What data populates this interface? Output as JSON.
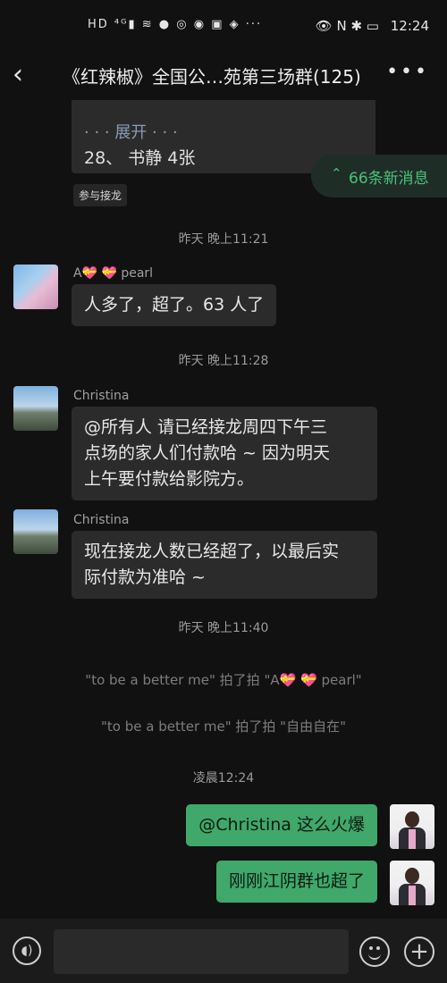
{
  "status_bar": {
    "left_icons": "HD ⁴ᴳ▮ ≋ ● ◎ ◉ ▣ ◈ ···",
    "right_icons": "👁 N ✱ ▭",
    "time": "12:24"
  },
  "header": {
    "title": "《红辣椒》全国公…苑第三场群(125)",
    "back_icon": "‹",
    "more_icon": "•••"
  },
  "card": {
    "expand": "· · · 展开 · · ·",
    "line": "28、 书静  4张"
  },
  "join_tag": "参与接龙",
  "new_messages": {
    "chevron": "⌃",
    "text": "66条新消息",
    "color": "#4cc07b"
  },
  "messages": [
    {
      "time": "昨天 晚上11:21",
      "sender": "A💝 💝  pearl",
      "text": "人多了，超了。63 人了"
    },
    {
      "time": "昨天 晚上11:28",
      "sender": "Christina",
      "lines": [
        "@所有人  请已经接龙周四下午三",
        "点场的家人们付款哈 ~  因为明天",
        "上午要付款给影院方。"
      ]
    },
    {
      "sender": "Christina",
      "lines": [
        "现在接龙人数已经超了，以最后实",
        "际付款为准哈 ~"
      ]
    },
    {
      "time": "昨天 晚上11:40"
    }
  ],
  "system": [
    "\"to be a better me\" 拍了拍 \"A💝 💝  pearl\"",
    "\"to be a better me\" 拍了拍 \"自由自在\""
  ],
  "my_messages": {
    "time": "凌晨12:24",
    "items": [
      "@Christina  这么火爆",
      "刚刚江阴群也超了"
    ]
  },
  "input_bar": {
    "voice_icon": "◖)",
    "plus_icon": "+"
  }
}
